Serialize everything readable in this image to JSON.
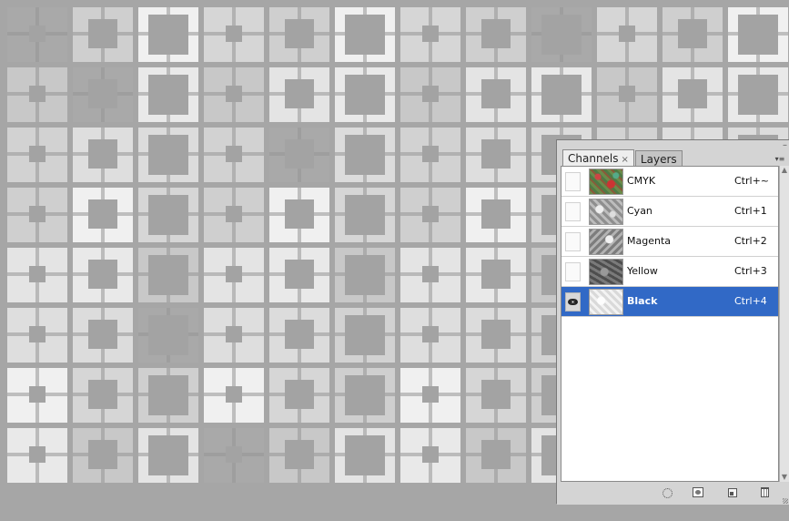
{
  "canvas": {
    "pattern": "grayscale-square-tile-grid"
  },
  "panel": {
    "close_glyph": "×",
    "collapse_glyph": "–",
    "menu_glyph": "▾≡",
    "tabs": [
      {
        "label": "Channels",
        "close_glyph": "×",
        "active": true
      },
      {
        "label": "Layers",
        "active": false
      }
    ],
    "channels": [
      {
        "name": "CMYK",
        "shortcut": "Ctrl+~",
        "visible": false,
        "selected": false,
        "thumb": "cmyk"
      },
      {
        "name": "Cyan",
        "shortcut": "Ctrl+1",
        "visible": false,
        "selected": false,
        "thumb": "cyan"
      },
      {
        "name": "Magenta",
        "shortcut": "Ctrl+2",
        "visible": false,
        "selected": false,
        "thumb": "magenta"
      },
      {
        "name": "Yellow",
        "shortcut": "Ctrl+3",
        "visible": false,
        "selected": false,
        "thumb": "yellow"
      },
      {
        "name": "Black",
        "shortcut": "Ctrl+4",
        "visible": true,
        "selected": true,
        "thumb": "black"
      }
    ],
    "bottom_buttons": [
      {
        "name": "load-channel-as-selection-button",
        "icon": "dotted-circle-icon"
      },
      {
        "name": "save-selection-as-channel-button",
        "icon": "mask-icon"
      },
      {
        "name": "create-new-channel-button",
        "icon": "new-page-icon"
      },
      {
        "name": "delete-channel-button",
        "icon": "trash-icon"
      }
    ],
    "colors": {
      "selected_row": "#3169c6",
      "panel_bg": "#d4d4d4",
      "list_bg": "#ffffff"
    }
  }
}
